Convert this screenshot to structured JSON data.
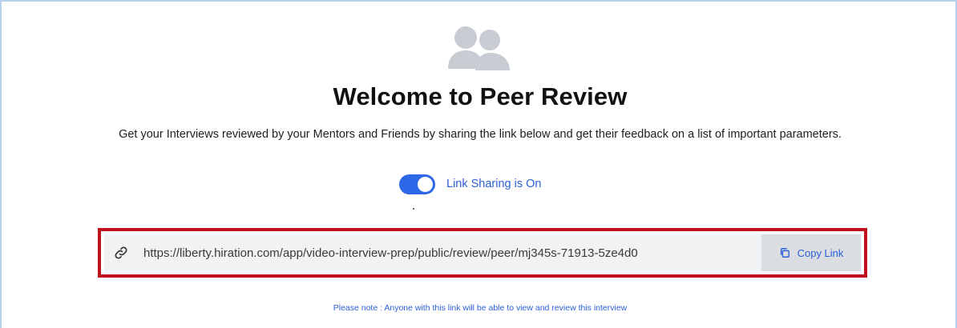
{
  "header": {
    "icon": "users-group-icon",
    "title": "Welcome to Peer Review",
    "description": "Get your Interviews reviewed by your Mentors and Friends by sharing the link below and get their feedback on a list of important parameters."
  },
  "sharing": {
    "enabled": true,
    "label": "Link Sharing is On"
  },
  "link": {
    "icon": "link-icon",
    "url": "https://liberty.hiration.com/app/video-interview-prep/public/review/peer/mj345s-71913-5ze4d0",
    "copy_icon": "copy-icon",
    "copy_label": "Copy Link"
  },
  "note": "Please note : Anyone with this link will be able to view and review this interview",
  "colors": {
    "accent": "#2d67e8",
    "link_text": "#2b5fd9",
    "highlight_border": "#c0111f",
    "frame_border": "#b7d2ee",
    "icon_gray": "#c8ccd3"
  }
}
